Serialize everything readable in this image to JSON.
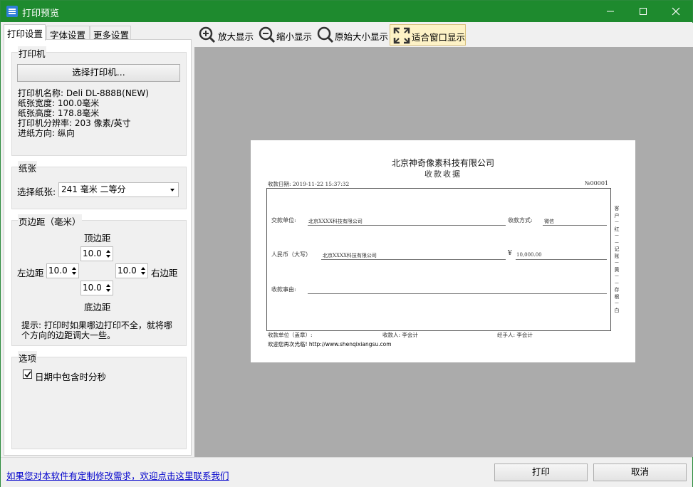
{
  "window": {
    "title": "打印预览"
  },
  "tabs": [
    {
      "label": "打印设置"
    },
    {
      "label": "字体设置"
    },
    {
      "label": "更多设置"
    }
  ],
  "printer": {
    "group_title": "打印机",
    "select_button": "选择打印机...",
    "name": "打印机名称: Deli DL-888B(NEW)",
    "paper_width": "纸张宽度: 100.0毫米",
    "paper_height": "纸张高度: 178.8毫米",
    "resolution": "打印机分辨率: 203 像素/英寸",
    "feed_direction": "进纸方向: 纵向"
  },
  "paper": {
    "group_title": "纸张",
    "select_label": "选择纸张:",
    "selected": "241 毫米 二等分"
  },
  "margins": {
    "group_title": "页边距（毫米）",
    "top_label": "顶边距",
    "top_value": "10.0",
    "left_label": "左边距",
    "left_value": "10.0",
    "right_label": "右边距",
    "right_value": "10.0",
    "bottom_label": "底边距",
    "bottom_value": "10.0",
    "hint_line1": "提示: 打印时如果哪边打印不全，就将哪",
    "hint_line2": "个方向的边距调大一些。"
  },
  "options": {
    "group_title": "选项",
    "include_time_label": "日期中包含时分秒",
    "include_time_checked": true
  },
  "toolbar": {
    "zoom_in": "放大显示",
    "zoom_out": "缩小显示",
    "original_size": "原始大小显示",
    "fit_window": "适合窗口显示"
  },
  "receipt": {
    "company": "北京神奇像素科技有限公司",
    "doc_title": "收款收据",
    "date": "收款日期: 2019-11-22 15:37:32",
    "number": "№00001",
    "payer_label": "交款单位:",
    "payer_value": "北京XXXX科技有限公司",
    "method_label": "收款方式:",
    "method_value": "微信",
    "amount_cn_label": "人民币（大写）",
    "amount_cn_value": "北京XXXX科技有限公司",
    "currency_symbol": "¥",
    "amount_value": "10,000.00",
    "reason_label": "收款事由:",
    "footer_unit": "收款单位（盖章）:",
    "footer_payee": "收款人:  李会计",
    "footer_handler": "经手人:  李会计",
    "footer_thanks": "欢迎您再次光临! http://www.shenqixiangsu.com",
    "side_note": [
      "客",
      "户",
      "－",
      "红",
      "－",
      "－",
      "记",
      "账",
      "－",
      "黄",
      "－",
      "－",
      "存",
      "根",
      "－",
      "白"
    ]
  },
  "bottom": {
    "link": "如果您对本软件有定制修改需求，欢迎点击这里联系我们",
    "print_button": "打印",
    "cancel_button": "取消"
  },
  "colors": {
    "titlebar": "#1e8a2e",
    "preview_bg": "#ababab",
    "link": "#0000cc"
  }
}
